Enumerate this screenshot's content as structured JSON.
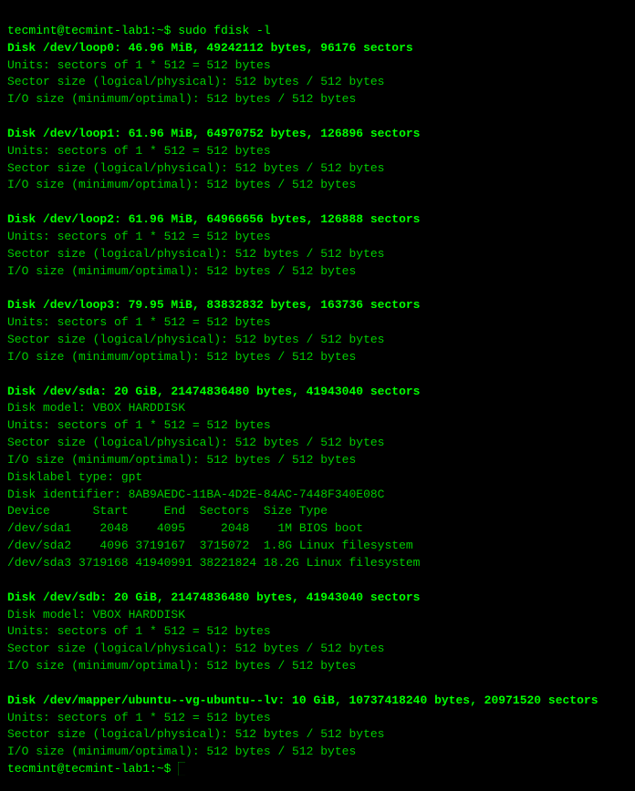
{
  "terminal": {
    "prompt_user": "tecmint@tecmint-lab1:~$",
    "command": " sudo fdisk -l",
    "blocks": [
      {
        "id": "loop0",
        "header": "Disk /dev/loop0: 46.96 MiB, 49242112 bytes, 96176 sectors",
        "lines": [
          "Units: sectors of 1 * 512 = 512 bytes",
          "Sector size (logical/physical): 512 bytes / 512 bytes",
          "I/O size (minimum/optimal): 512 bytes / 512 bytes"
        ]
      },
      {
        "id": "loop1",
        "header": "Disk /dev/loop1: 61.96 MiB, 64970752 bytes, 126896 sectors",
        "lines": [
          "Units: sectors of 1 * 512 = 512 bytes",
          "Sector size (logical/physical): 512 bytes / 512 bytes",
          "I/O size (minimum/optimal): 512 bytes / 512 bytes"
        ]
      },
      {
        "id": "loop2",
        "header": "Disk /dev/loop2: 61.96 MiB, 64966656 bytes, 126888 sectors",
        "lines": [
          "Units: sectors of 1 * 512 = 512 bytes",
          "Sector size (logical/physical): 512 bytes / 512 bytes",
          "I/O size (minimum/optimal): 512 bytes / 512 bytes"
        ]
      },
      {
        "id": "loop3",
        "header": "Disk /dev/loop3: 79.95 MiB, 83832832 bytes, 163736 sectors",
        "lines": [
          "Units: sectors of 1 * 512 = 512 bytes",
          "Sector size (logical/physical): 512 bytes / 512 bytes",
          "I/O size (minimum/optimal): 512 bytes / 512 bytes"
        ]
      },
      {
        "id": "sda",
        "header": "Disk /dev/sda: 20 GiB, 21474836480 bytes, 41943040 sectors",
        "lines": [
          "Disk model: VBOX HARDDISK",
          "Units: sectors of 1 * 512 = 512 bytes",
          "Sector size (logical/physical): 512 bytes / 512 bytes",
          "I/O size (minimum/optimal): 512 bytes / 512 bytes",
          "Disklabel type: gpt",
          "Disk identifier: 8AB9AEDC-11BA-4D2E-84AC-7448F340E08C"
        ],
        "table_header": "Device      Start     End  Sectors  Size Type",
        "table_rows": [
          "/dev/sda1    2048    4095     2048    1M BIOS boot",
          "/dev/sda2    4096 3719167  3715072  1.8G Linux filesystem",
          "/dev/sda3 3719168 41940991 38221824 18.2G Linux filesystem"
        ]
      },
      {
        "id": "sdb",
        "header": "Disk /dev/sdb: 20 GiB, 21474836480 bytes, 41943040 sectors",
        "lines": [
          "Disk model: VBOX HARDDISK",
          "Units: sectors of 1 * 512 = 512 bytes",
          "Sector size (logical/physical): 512 bytes / 512 bytes",
          "I/O size (minimum/optimal): 512 bytes / 512 bytes"
        ]
      },
      {
        "id": "mapper",
        "header": "Disk /dev/mapper/ubuntu--vg-ubuntu--lv: 10 GiB, 10737418240 bytes, 20971520 sectors",
        "lines": [
          "Units: sectors of 1 * 512 = 512 bytes",
          "Sector size (logical/physical): 512 bytes / 512 bytes",
          "I/O size (minimum/optimal): 512 bytes / 512 bytes"
        ]
      }
    ],
    "final_prompt": "tecmint@tecmint-lab1:~$"
  }
}
